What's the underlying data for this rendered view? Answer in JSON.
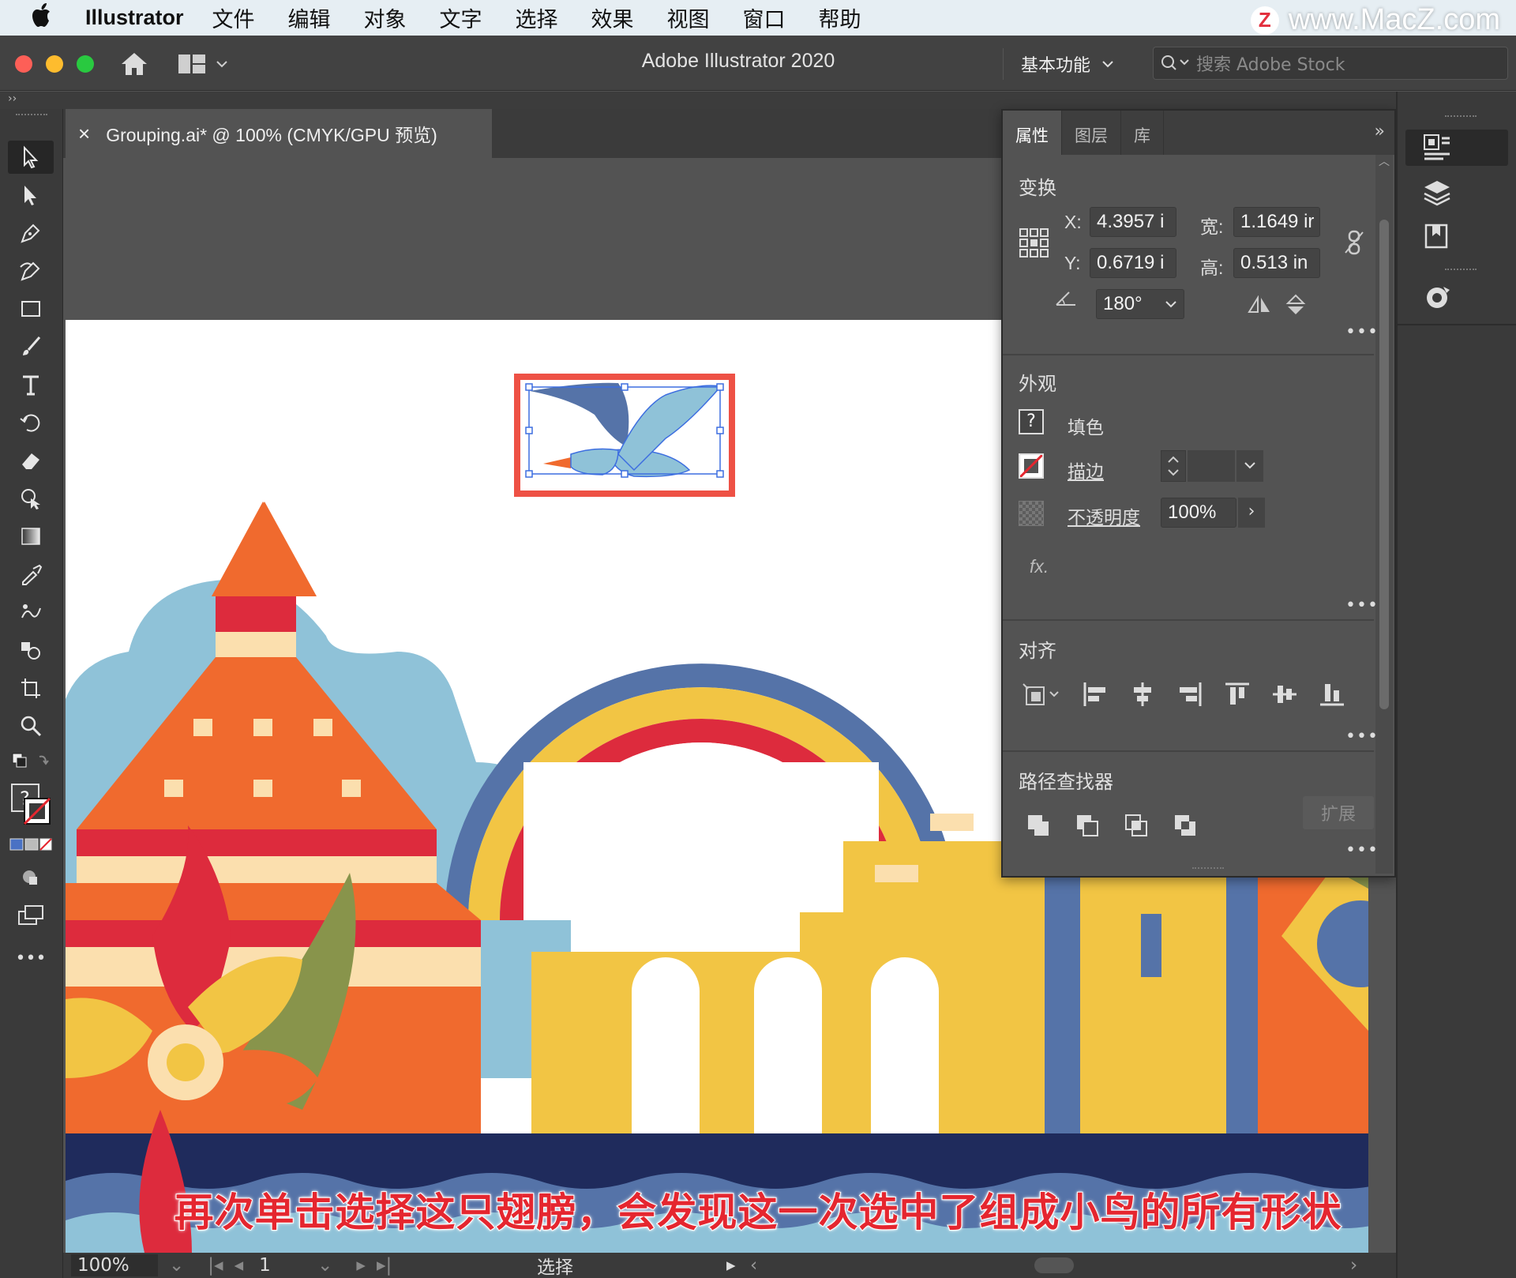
{
  "menubar": {
    "app_name": "Illustrator",
    "items": [
      "文件",
      "编辑",
      "对象",
      "文字",
      "选择",
      "效果",
      "视图",
      "窗口",
      "帮助"
    ],
    "watermark": "www.MacZ.com",
    "watermark_logo": "Z"
  },
  "titlebar": {
    "title": "Adobe Illustrator 2020",
    "workspace": "基本功能",
    "search_placeholder": "搜索 Adobe Stock"
  },
  "document": {
    "tab_title": "Grouping.ai* @ 100% (CMYK/GPU 预览)",
    "close_glyph": "×"
  },
  "panel": {
    "tabs": [
      "属性",
      "图层",
      "库"
    ],
    "transform": {
      "title": "变换",
      "x_label": "X:",
      "x_value": "4.3957 i",
      "y_label": "Y:",
      "y_value": "0.6719 i",
      "w_label": "宽:",
      "w_value": "1.1649 ir",
      "h_label": "高:",
      "h_value": "0.513 in",
      "angle_value": "180°"
    },
    "appearance": {
      "title": "外观",
      "fill_label": "填色",
      "stroke_label": "描边",
      "opacity_label": "不透明度",
      "opacity_value": "100%",
      "fx_label": "fx."
    },
    "align": {
      "title": "对齐"
    },
    "pathfinder": {
      "title": "路径查找器",
      "expand_label": "扩展"
    },
    "more_glyph": "•••"
  },
  "statusbar": {
    "zoom": "100%",
    "page": "1",
    "status_text": "选择"
  },
  "subtitle": "再次单击选择这只翅膀，会发现这一次选中了组成小鸟的所有形状",
  "colors": {
    "accent_red": "#e5262f",
    "selection_blue": "#3d6ee0",
    "highlight_box": "#ee5145",
    "orange": "#f06a2e",
    "yellow": "#f2c544",
    "navy": "#1f2b5c",
    "sky_blue": "#8fc2d8",
    "steel_blue": "#5573a8"
  },
  "icons": {
    "toolbar": [
      "selection-tool-icon",
      "direct-selection-tool-icon",
      "pen-tool-icon",
      "curvature-tool-icon",
      "rectangle-tool-icon",
      "paintbrush-tool-icon",
      "type-tool-icon",
      "rotate-tool-icon",
      "eraser-tool-icon",
      "shape-builder-tool-icon",
      "gradient-tool-icon",
      "eyedropper-tool-icon",
      "puppet-warp-tool-icon",
      "blend-tool-icon",
      "artboard-tool-icon",
      "zoom-tool-icon"
    ]
  }
}
